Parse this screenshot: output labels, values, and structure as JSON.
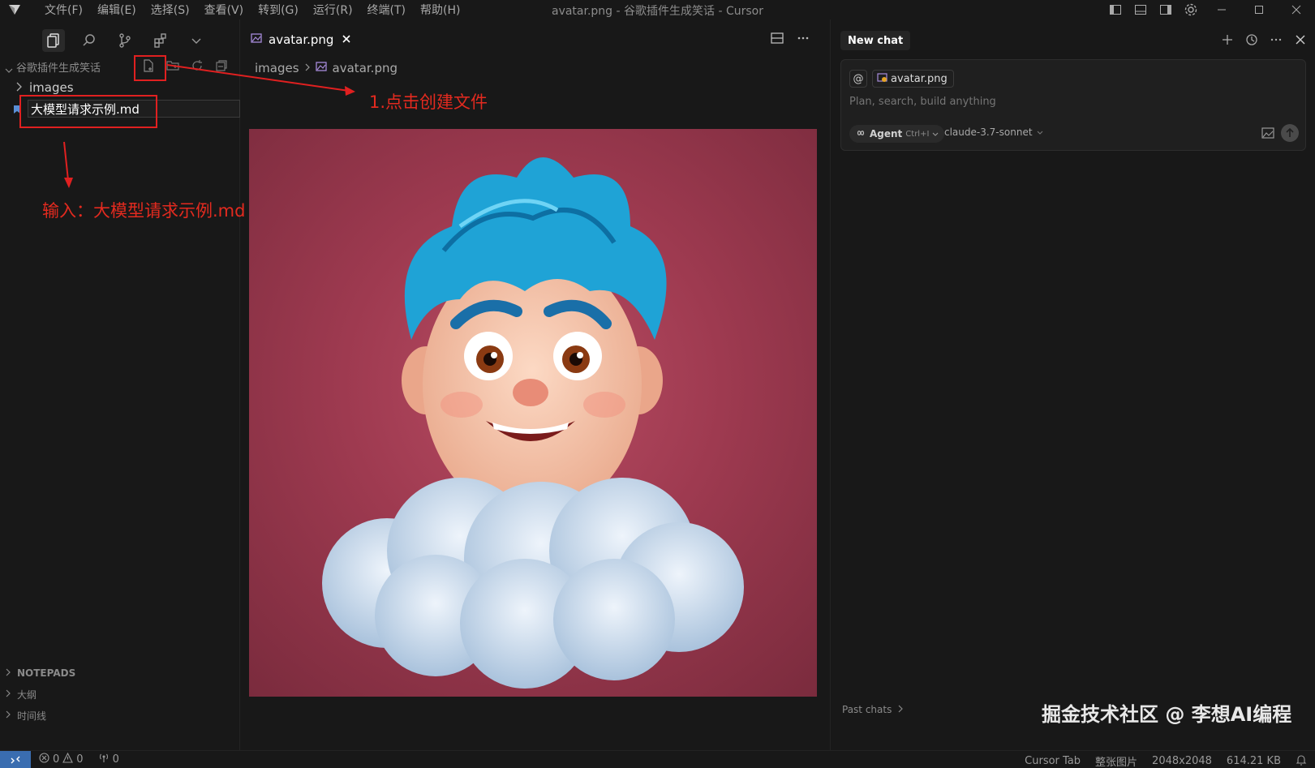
{
  "titlebar": {
    "menus": [
      "文件(F)",
      "编辑(E)",
      "选择(S)",
      "查看(V)",
      "转到(G)",
      "运行(R)",
      "终端(T)",
      "帮助(H)"
    ],
    "window_title": "avatar.png - 谷歌插件生成笑话 - Cursor"
  },
  "sidebar": {
    "explorer_title": "谷歌插件生成笑话",
    "folder_label": "images",
    "new_file_value": "大模型请求示例.md",
    "sections": [
      "NOTEPADS",
      "大纲",
      "时间线"
    ]
  },
  "annotations": {
    "click_create": "1.点击创建文件",
    "input_hint": "输入：大模型请求示例.md"
  },
  "editor": {
    "tab_label": "avatar.png",
    "breadcrumb_folder": "images",
    "breadcrumb_file": "avatar.png"
  },
  "chat": {
    "tab_label": "New chat",
    "context_file": "avatar.png",
    "placeholder": "Plan, search, build anything",
    "agent_label": "Agent",
    "agent_shortcut": "Ctrl+I",
    "model": "claude-3.7-sonnet",
    "past_chats": "Past chats",
    "watermark": "掘金技术社区 @ 李想AI编程"
  },
  "statusbar": {
    "errors": "0",
    "warnings": "0",
    "ports": "0",
    "cursor_tab": "Cursor Tab",
    "view_mode": "整张图片",
    "dimensions": "2048x2048",
    "file_size": "614.21 KB"
  },
  "colors": {
    "annotation_red": "#e02020",
    "remote_blue": "#3a6db0",
    "image_bg": "#9e3a50",
    "hair_blue": "#1fa3d6"
  }
}
